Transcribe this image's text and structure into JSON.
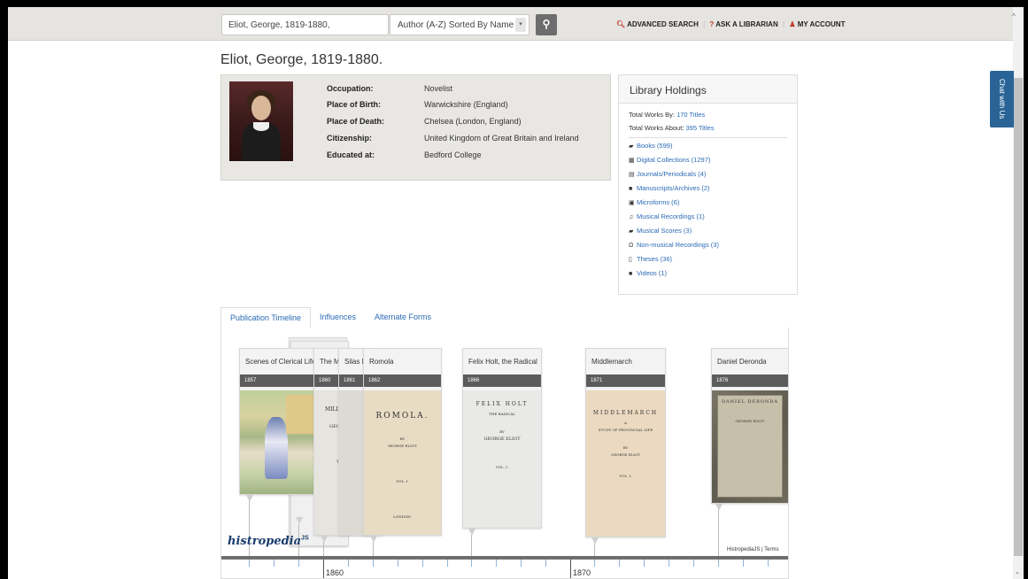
{
  "search": {
    "value": "Eliot, George, 1819-1880,",
    "sort_label": "Author (A-Z) Sorted By Name"
  },
  "toplinks": {
    "advanced": "ADVANCED SEARCH",
    "ask": "ASK A LIBRARIAN",
    "account": "MY ACCOUNT"
  },
  "page_title": "Eliot, George, 1819-1880.",
  "info": [
    {
      "label": "Occupation:",
      "value": "Novelist"
    },
    {
      "label": "Place of Birth:",
      "value": "Warwickshire (England)"
    },
    {
      "label": "Place of Death:",
      "value": "Chelsea (London, England)"
    },
    {
      "label": "Citizenship:",
      "value": "United Kingdom of Great Britain and Ireland"
    },
    {
      "label": "Educated at:",
      "value": "Bedford College"
    }
  ],
  "holdings": {
    "title": "Library Holdings",
    "total_by_label": "Total Works By:",
    "total_by_link": "170 Titles",
    "total_about_label": "Total Works About:",
    "total_about_link": "395 Titles",
    "items": [
      {
        "icon": "book-icon",
        "label": "Books (599)"
      },
      {
        "icon": "grid-icon",
        "label": "Digital Collections (1297)"
      },
      {
        "icon": "journal-icon",
        "label": "Journals/Periodicals (4)"
      },
      {
        "icon": "archive-icon",
        "label": "Manuscripts/Archives (2)"
      },
      {
        "icon": "film-icon",
        "label": "Microforms (6)"
      },
      {
        "icon": "music-icon",
        "label": "Musical Recordings (1)"
      },
      {
        "icon": "score-icon",
        "label": "Musical Scores (3)"
      },
      {
        "icon": "headphones-icon",
        "label": "Non-musical Recordings (3)"
      },
      {
        "icon": "document-icon",
        "label": "Theses (36)"
      },
      {
        "icon": "video-icon",
        "label": "Videos (1)"
      }
    ]
  },
  "chat": "Chat with Us",
  "tabs": [
    "Publication Timeline",
    "Influences",
    "Alternate Forms"
  ],
  "timeline": {
    "cards": [
      {
        "title": "Scenes of Clerical Life",
        "year": "1857",
        "cover_text": []
      },
      {
        "title": "The M",
        "year": "1860",
        "cover_text": [
          "THE",
          "MILL ON THE",
          "BY",
          "GEORGE ELI",
          "VOL. I."
        ]
      },
      {
        "title": "Silas M",
        "year": "1861",
        "cover_text": []
      },
      {
        "title": "Romola",
        "year": "1862",
        "cover_text": [
          "ROMOLA.",
          "BY",
          "GEORGE ELIOT.",
          "VOL. I.",
          "LONDON:"
        ]
      },
      {
        "title": "Felix Holt, the Radical",
        "year": "1866",
        "cover_text": [
          "FELIX HOLT",
          "THE RADICAL",
          "BY",
          "GEORGE ELIOT",
          "VOL. I."
        ]
      },
      {
        "title": "Middlemarch",
        "year": "1871",
        "cover_text": [
          "MIDDLEMARCH",
          "A",
          "STUDY OF PROVINCIAL LIFE",
          "BY",
          "GEORGE ELIOT",
          "VOL. I."
        ]
      },
      {
        "title": "Daniel Deronda",
        "year": "1876",
        "cover_text": [
          "DANIEL DERONDA",
          "GEORGE ELIOT"
        ]
      }
    ],
    "axis_labels": [
      "1860",
      "1870"
    ],
    "logo": "histropedia",
    "logo_sup": "JS",
    "terms": "HistropediaJS | Terms"
  },
  "colors": {
    "link": "#2a6ab5",
    "chat_bg": "#2a6496",
    "search_btn": "#6d6d6d"
  }
}
